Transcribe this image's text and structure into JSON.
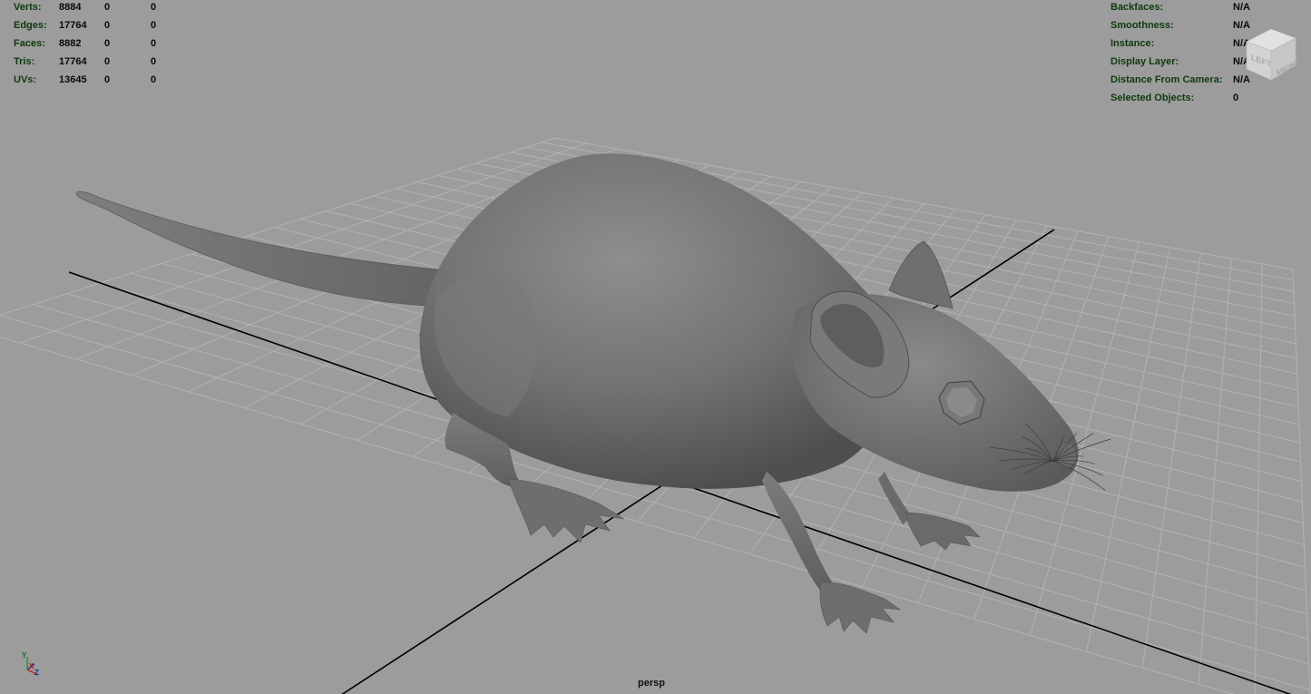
{
  "viewport": {
    "camera_label": "persp",
    "background_color": "#9c9c9c",
    "grid_color": "#b2b2b2",
    "axis_line_color": "#000000",
    "model": "rat-mesh"
  },
  "stats_hud": {
    "rows": [
      {
        "label": "Verts:",
        "v1": "8884",
        "v2": "0",
        "v3": "0"
      },
      {
        "label": "Edges:",
        "v1": "17764",
        "v2": "0",
        "v3": "0"
      },
      {
        "label": "Faces:",
        "v1": "8882",
        "v2": "0",
        "v3": "0"
      },
      {
        "label": "Tris:",
        "v1": "17764",
        "v2": "0",
        "v3": "0"
      },
      {
        "label": "UVs:",
        "v1": "13645",
        "v2": "0",
        "v3": "0"
      }
    ]
  },
  "info_hud": {
    "rows": [
      {
        "label": "Backfaces:",
        "value": "N/A"
      },
      {
        "label": "Smoothness:",
        "value": "N/A"
      },
      {
        "label": "Instance:",
        "value": "N/A"
      },
      {
        "label": "Display Layer:",
        "value": "N/A"
      },
      {
        "label": "Distance From Camera:",
        "value": "N/A"
      },
      {
        "label": "Selected Objects:",
        "value": "0"
      }
    ]
  },
  "view_cube": {
    "left_face": "LEFT",
    "front_face": "FRONT",
    "icon": "view-cube-icon"
  },
  "axis_gizmo": {
    "x": "X",
    "y": "Y",
    "z": "Z",
    "x_color": "#d02020",
    "y_color": "#20a020",
    "z_color": "#2040d0"
  }
}
